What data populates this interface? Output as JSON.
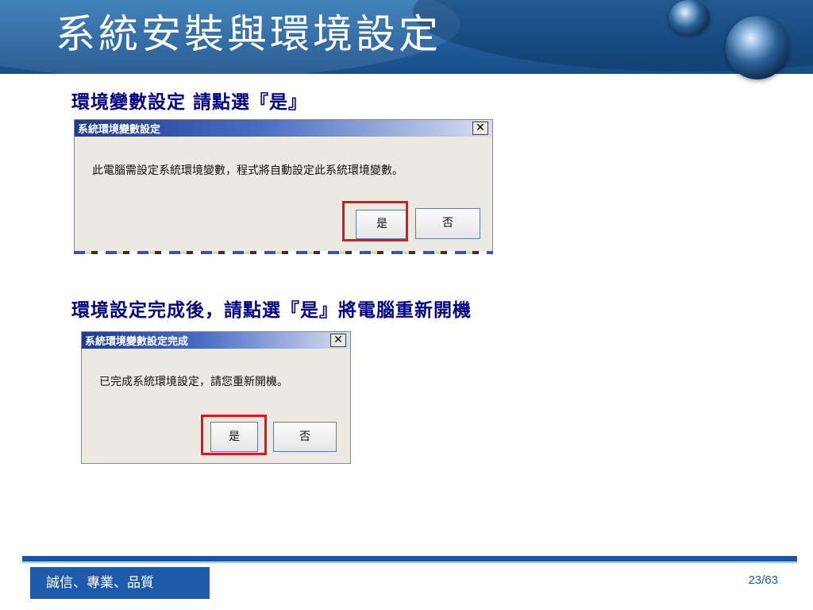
{
  "slide": {
    "title": "系統安裝與環境設定",
    "heading1": "環境變數設定  請點選『是』",
    "heading2": "環境設定完成後，請點選『是』將電腦重新開機",
    "footer_motto": "誠信、專業、品質",
    "page_number": "23/63"
  },
  "dialog1": {
    "title": "系統環境變數設定",
    "close_glyph": "✕",
    "message": "此電腦需設定系統環境變數，程式將自動設定此系統環境變數。",
    "yes_label": "是",
    "no_label": "否"
  },
  "dialog2": {
    "title": "系統環境變數設定完成",
    "close_glyph": "✕",
    "message": "已完成系統環境設定，請您重新開機。",
    "yes_label": "是",
    "no_label": "否"
  },
  "colors": {
    "banner": "#1f5e9d",
    "heading": "#000088",
    "highlight": "#e8121b",
    "footer": "#1d5aab"
  }
}
